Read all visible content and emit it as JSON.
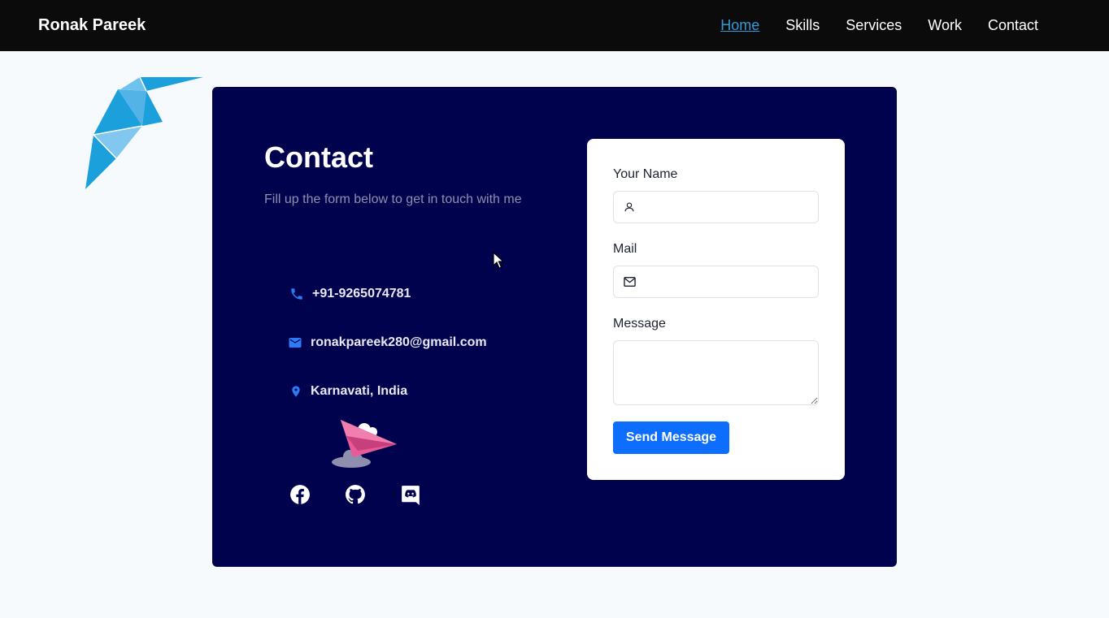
{
  "navbar": {
    "brand": "Ronak Pareek",
    "links": [
      {
        "label": "Home",
        "active": true
      },
      {
        "label": "Skills",
        "active": false
      },
      {
        "label": "Services",
        "active": false
      },
      {
        "label": "Work",
        "active": false
      },
      {
        "label": "Contact",
        "active": false
      }
    ]
  },
  "contact": {
    "title": "Contact",
    "subtitle": "Fill up the form below to get in touch with me",
    "phone": "+91-9265074781",
    "email": "ronakpareek280@gmail.com",
    "location": "Karnavati, India",
    "icons": {
      "phone": "phone-icon",
      "email": "envelope-icon",
      "location": "map-pin-icon"
    },
    "socials": [
      "facebook-icon",
      "github-icon",
      "discord-icon"
    ]
  },
  "form": {
    "name_label": "Your Name",
    "name_value": "",
    "mail_label": "Mail",
    "mail_value": "",
    "message_label": "Message",
    "message_value": "",
    "submit_label": "Send Message"
  },
  "colors": {
    "navbar_bg": "#0b0b0b",
    "nav_active": "#2f9bd9",
    "card_bg": "#01024d",
    "accent_blue": "#0d6efd",
    "page_bg": "#f7fafd"
  }
}
